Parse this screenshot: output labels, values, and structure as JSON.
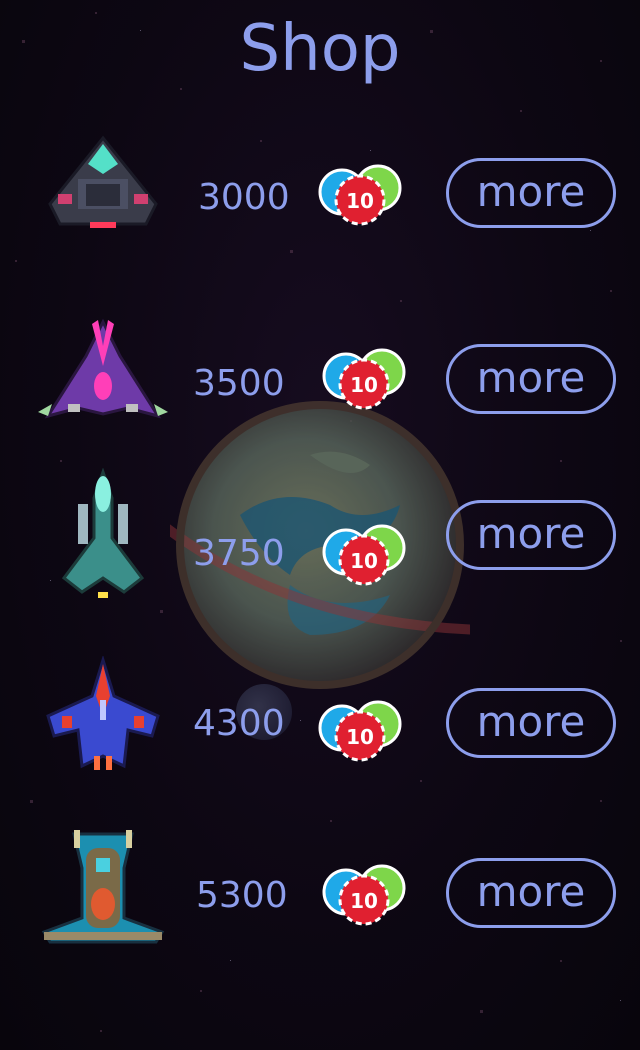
{
  "screen": {
    "title": "Shop"
  },
  "colors": {
    "accent": "#8d9eec",
    "background": "#0c0712"
  },
  "items": [
    {
      "ship": "gray-cyan-delta-ship-sprite",
      "price": "3000",
      "currency_icon": "chip-stack-icon",
      "button_label": "more"
    },
    {
      "ship": "purple-magenta-fighter-sprite",
      "price": "3500",
      "currency_icon": "chip-stack-icon",
      "button_label": "more"
    },
    {
      "ship": "teal-narrow-fighter-sprite",
      "price": "3750",
      "currency_icon": "chip-stack-icon",
      "button_label": "more"
    },
    {
      "ship": "red-blue-winged-fighter-sprite",
      "price": "4300",
      "currency_icon": "chip-stack-icon",
      "button_label": "more"
    },
    {
      "ship": "cyan-orange-gunship-sprite",
      "price": "5300",
      "currency_icon": "chip-stack-icon",
      "button_label": "more"
    }
  ],
  "chip_label": "10"
}
